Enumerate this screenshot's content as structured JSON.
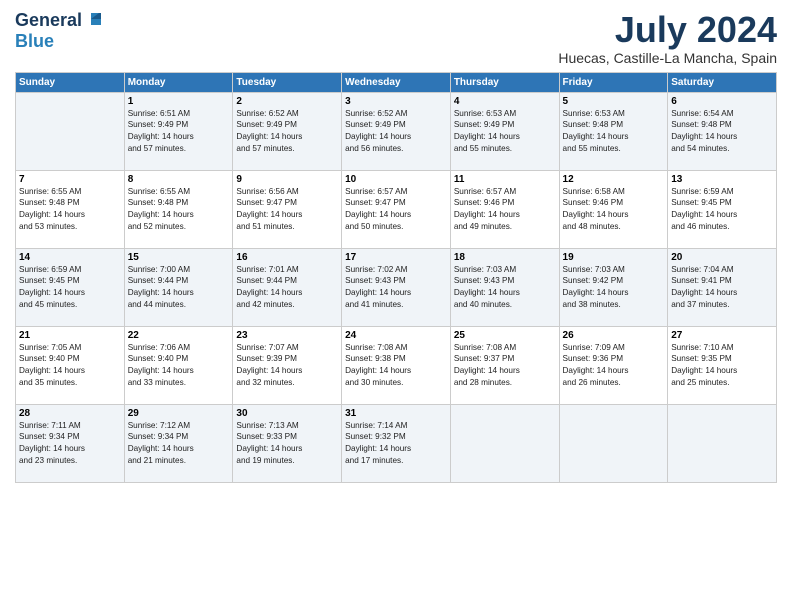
{
  "logo": {
    "line1": "General",
    "line2": "Blue"
  },
  "header": {
    "month": "July 2024",
    "location": "Huecas, Castille-La Mancha, Spain"
  },
  "days_of_week": [
    "Sunday",
    "Monday",
    "Tuesday",
    "Wednesday",
    "Thursday",
    "Friday",
    "Saturday"
  ],
  "weeks": [
    [
      {
        "day": "",
        "sunrise": "",
        "sunset": "",
        "daylight": ""
      },
      {
        "day": "1",
        "sunrise": "Sunrise: 6:51 AM",
        "sunset": "Sunset: 9:49 PM",
        "daylight": "Daylight: 14 hours and 57 minutes."
      },
      {
        "day": "2",
        "sunrise": "Sunrise: 6:52 AM",
        "sunset": "Sunset: 9:49 PM",
        "daylight": "Daylight: 14 hours and 57 minutes."
      },
      {
        "day": "3",
        "sunrise": "Sunrise: 6:52 AM",
        "sunset": "Sunset: 9:49 PM",
        "daylight": "Daylight: 14 hours and 56 minutes."
      },
      {
        "day": "4",
        "sunrise": "Sunrise: 6:53 AM",
        "sunset": "Sunset: 9:49 PM",
        "daylight": "Daylight: 14 hours and 55 minutes."
      },
      {
        "day": "5",
        "sunrise": "Sunrise: 6:53 AM",
        "sunset": "Sunset: 9:48 PM",
        "daylight": "Daylight: 14 hours and 55 minutes."
      },
      {
        "day": "6",
        "sunrise": "Sunrise: 6:54 AM",
        "sunset": "Sunset: 9:48 PM",
        "daylight": "Daylight: 14 hours and 54 minutes."
      }
    ],
    [
      {
        "day": "7",
        "sunrise": "Sunrise: 6:55 AM",
        "sunset": "Sunset: 9:48 PM",
        "daylight": "Daylight: 14 hours and 53 minutes."
      },
      {
        "day": "8",
        "sunrise": "Sunrise: 6:55 AM",
        "sunset": "Sunset: 9:48 PM",
        "daylight": "Daylight: 14 hours and 52 minutes."
      },
      {
        "day": "9",
        "sunrise": "Sunrise: 6:56 AM",
        "sunset": "Sunset: 9:47 PM",
        "daylight": "Daylight: 14 hours and 51 minutes."
      },
      {
        "day": "10",
        "sunrise": "Sunrise: 6:57 AM",
        "sunset": "Sunset: 9:47 PM",
        "daylight": "Daylight: 14 hours and 50 minutes."
      },
      {
        "day": "11",
        "sunrise": "Sunrise: 6:57 AM",
        "sunset": "Sunset: 9:46 PM",
        "daylight": "Daylight: 14 hours and 49 minutes."
      },
      {
        "day": "12",
        "sunrise": "Sunrise: 6:58 AM",
        "sunset": "Sunset: 9:46 PM",
        "daylight": "Daylight: 14 hours and 48 minutes."
      },
      {
        "day": "13",
        "sunrise": "Sunrise: 6:59 AM",
        "sunset": "Sunset: 9:45 PM",
        "daylight": "Daylight: 14 hours and 46 minutes."
      }
    ],
    [
      {
        "day": "14",
        "sunrise": "Sunrise: 6:59 AM",
        "sunset": "Sunset: 9:45 PM",
        "daylight": "Daylight: 14 hours and 45 minutes."
      },
      {
        "day": "15",
        "sunrise": "Sunrise: 7:00 AM",
        "sunset": "Sunset: 9:44 PM",
        "daylight": "Daylight: 14 hours and 44 minutes."
      },
      {
        "day": "16",
        "sunrise": "Sunrise: 7:01 AM",
        "sunset": "Sunset: 9:44 PM",
        "daylight": "Daylight: 14 hours and 42 minutes."
      },
      {
        "day": "17",
        "sunrise": "Sunrise: 7:02 AM",
        "sunset": "Sunset: 9:43 PM",
        "daylight": "Daylight: 14 hours and 41 minutes."
      },
      {
        "day": "18",
        "sunrise": "Sunrise: 7:03 AM",
        "sunset": "Sunset: 9:43 PM",
        "daylight": "Daylight: 14 hours and 40 minutes."
      },
      {
        "day": "19",
        "sunrise": "Sunrise: 7:03 AM",
        "sunset": "Sunset: 9:42 PM",
        "daylight": "Daylight: 14 hours and 38 minutes."
      },
      {
        "day": "20",
        "sunrise": "Sunrise: 7:04 AM",
        "sunset": "Sunset: 9:41 PM",
        "daylight": "Daylight: 14 hours and 37 minutes."
      }
    ],
    [
      {
        "day": "21",
        "sunrise": "Sunrise: 7:05 AM",
        "sunset": "Sunset: 9:40 PM",
        "daylight": "Daylight: 14 hours and 35 minutes."
      },
      {
        "day": "22",
        "sunrise": "Sunrise: 7:06 AM",
        "sunset": "Sunset: 9:40 PM",
        "daylight": "Daylight: 14 hours and 33 minutes."
      },
      {
        "day": "23",
        "sunrise": "Sunrise: 7:07 AM",
        "sunset": "Sunset: 9:39 PM",
        "daylight": "Daylight: 14 hours and 32 minutes."
      },
      {
        "day": "24",
        "sunrise": "Sunrise: 7:08 AM",
        "sunset": "Sunset: 9:38 PM",
        "daylight": "Daylight: 14 hours and 30 minutes."
      },
      {
        "day": "25",
        "sunrise": "Sunrise: 7:08 AM",
        "sunset": "Sunset: 9:37 PM",
        "daylight": "Daylight: 14 hours and 28 minutes."
      },
      {
        "day": "26",
        "sunrise": "Sunrise: 7:09 AM",
        "sunset": "Sunset: 9:36 PM",
        "daylight": "Daylight: 14 hours and 26 minutes."
      },
      {
        "day": "27",
        "sunrise": "Sunrise: 7:10 AM",
        "sunset": "Sunset: 9:35 PM",
        "daylight": "Daylight: 14 hours and 25 minutes."
      }
    ],
    [
      {
        "day": "28",
        "sunrise": "Sunrise: 7:11 AM",
        "sunset": "Sunset: 9:34 PM",
        "daylight": "Daylight: 14 hours and 23 minutes."
      },
      {
        "day": "29",
        "sunrise": "Sunrise: 7:12 AM",
        "sunset": "Sunset: 9:34 PM",
        "daylight": "Daylight: 14 hours and 21 minutes."
      },
      {
        "day": "30",
        "sunrise": "Sunrise: 7:13 AM",
        "sunset": "Sunset: 9:33 PM",
        "daylight": "Daylight: 14 hours and 19 minutes."
      },
      {
        "day": "31",
        "sunrise": "Sunrise: 7:14 AM",
        "sunset": "Sunset: 9:32 PM",
        "daylight": "Daylight: 14 hours and 17 minutes."
      },
      {
        "day": "",
        "sunrise": "",
        "sunset": "",
        "daylight": ""
      },
      {
        "day": "",
        "sunrise": "",
        "sunset": "",
        "daylight": ""
      },
      {
        "day": "",
        "sunrise": "",
        "sunset": "",
        "daylight": ""
      }
    ]
  ]
}
